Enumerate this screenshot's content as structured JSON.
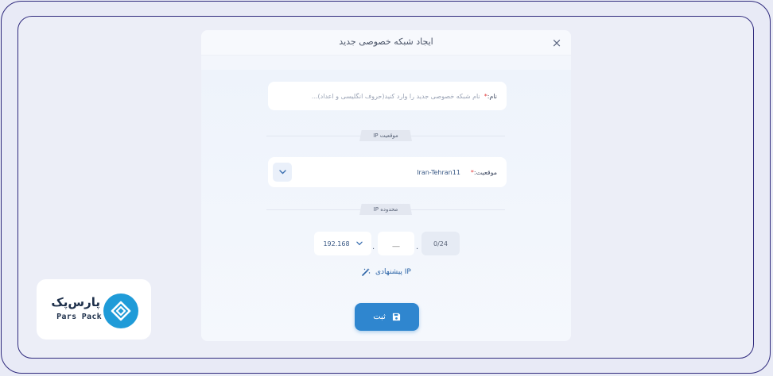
{
  "modal": {
    "title": "ایجاد شبکه خصوصی جدید",
    "close_icon": "×"
  },
  "name_field": {
    "label": "نام:",
    "required_mark": "*",
    "placeholder": "نام شبکه خصوصی جدید را وارد کنید(حروف انگلیسی و اعداد)...",
    "value": ""
  },
  "ip_location_section": {
    "title": "موقعیت IP"
  },
  "location_field": {
    "label": "موقعیت:",
    "required_mark": "*",
    "value": "Iran-Tehran11"
  },
  "ip_range_section": {
    "title": "محدوده IP"
  },
  "ip_range": {
    "prefix": "192.168",
    "separator": ".",
    "octet_placeholder": "__",
    "mask": "0/24"
  },
  "suggest_ip": {
    "label": "IP پیشنهادی"
  },
  "submit": {
    "label": "ثبت"
  },
  "brand": {
    "name_fa": "پارس‌پک",
    "name_en": "Pars Pack",
    "color": "#1f9bd8"
  }
}
